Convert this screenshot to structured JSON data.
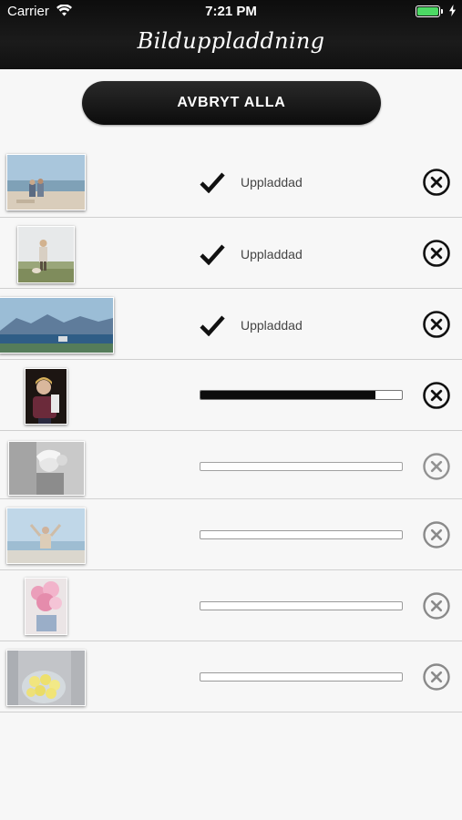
{
  "status_bar": {
    "carrier": "Carrier",
    "time": "7:21 PM",
    "battery_color": "#4cd964"
  },
  "nav": {
    "title": "Bilduppladdning"
  },
  "actions": {
    "cancel_all_label": "AVBRYT ALLA"
  },
  "uploads": [
    {
      "status": "Uppladdad",
      "state": "done",
      "thumb": "beach-couple"
    },
    {
      "status": "Uppladdad",
      "state": "done",
      "thumb": "woman-dunes"
    },
    {
      "status": "Uppladdad",
      "state": "done",
      "thumb": "mountain-lake"
    },
    {
      "state": "uploading",
      "progress": 0.87,
      "thumb": "boy-dark"
    },
    {
      "state": "pending",
      "progress": 0,
      "thumb": "bw-portrait"
    },
    {
      "state": "pending",
      "progress": 0,
      "thumb": "child-sea"
    },
    {
      "state": "pending",
      "progress": 0,
      "thumb": "pink-flowers"
    },
    {
      "state": "pending",
      "progress": 0,
      "thumb": "lemons"
    }
  ],
  "icons": {
    "done": "checkmark-icon",
    "remove": "close-circle-icon"
  }
}
